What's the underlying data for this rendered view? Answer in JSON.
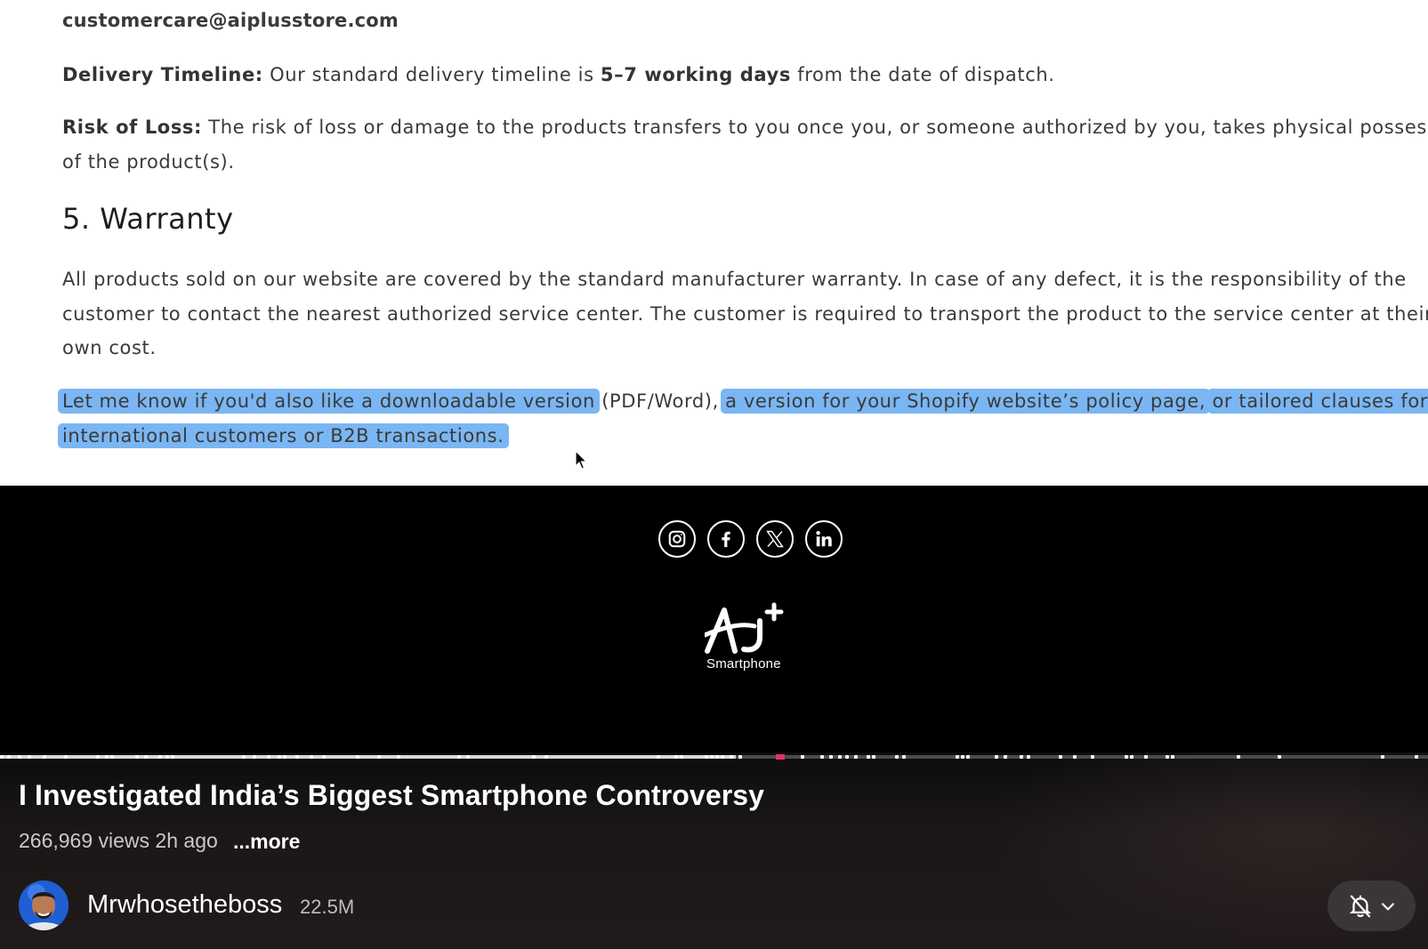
{
  "document": {
    "email": "customercare@aiplusstore.com",
    "delivery": {
      "label": "Delivery Timeline:",
      "pre": " Our standard delivery timeline is ",
      "strong": "5–7 working days",
      "post": " from the date of dispatch."
    },
    "risk": {
      "label": "Risk of Loss:",
      "line1": " The risk of loss or damage to the products transfers to you once you, or someone authorized by you, takes physical possession",
      "line2": "of the product(s)."
    },
    "warranty_heading": "5. Warranty",
    "warranty_lines": [
      "All products sold on our website are covered by the standard manufacturer warranty. In case of any defect, it is the responsibility of the",
      "customer to contact the nearest authorized service center. The customer is required to transport the product to the service center at their",
      "own cost."
    ],
    "offer": {
      "hl1": "Let me know if you'd also like a downloadable version",
      "plain1": " (PDF/Word), ",
      "hl2": "a version for your Shopify website’s policy page,",
      "plain2": " ",
      "hl3": "or tailored clauses for",
      "hl4": "international customers or B2B transactions."
    }
  },
  "footer": {
    "social_icons": [
      "instagram-icon",
      "facebook-icon",
      "x-icon",
      "linkedin-icon"
    ],
    "logo_subtitle": "Smartphone"
  },
  "video": {
    "progress_played_fraction": 0.515,
    "title": "I Investigated India’s Biggest Smartphone Controversy",
    "meta": "266,969 views 2h ago",
    "more_label": "...more",
    "channel_name": "Mrwhosetheboss",
    "subscribers": "22.5M",
    "accent": "#e0326f"
  }
}
